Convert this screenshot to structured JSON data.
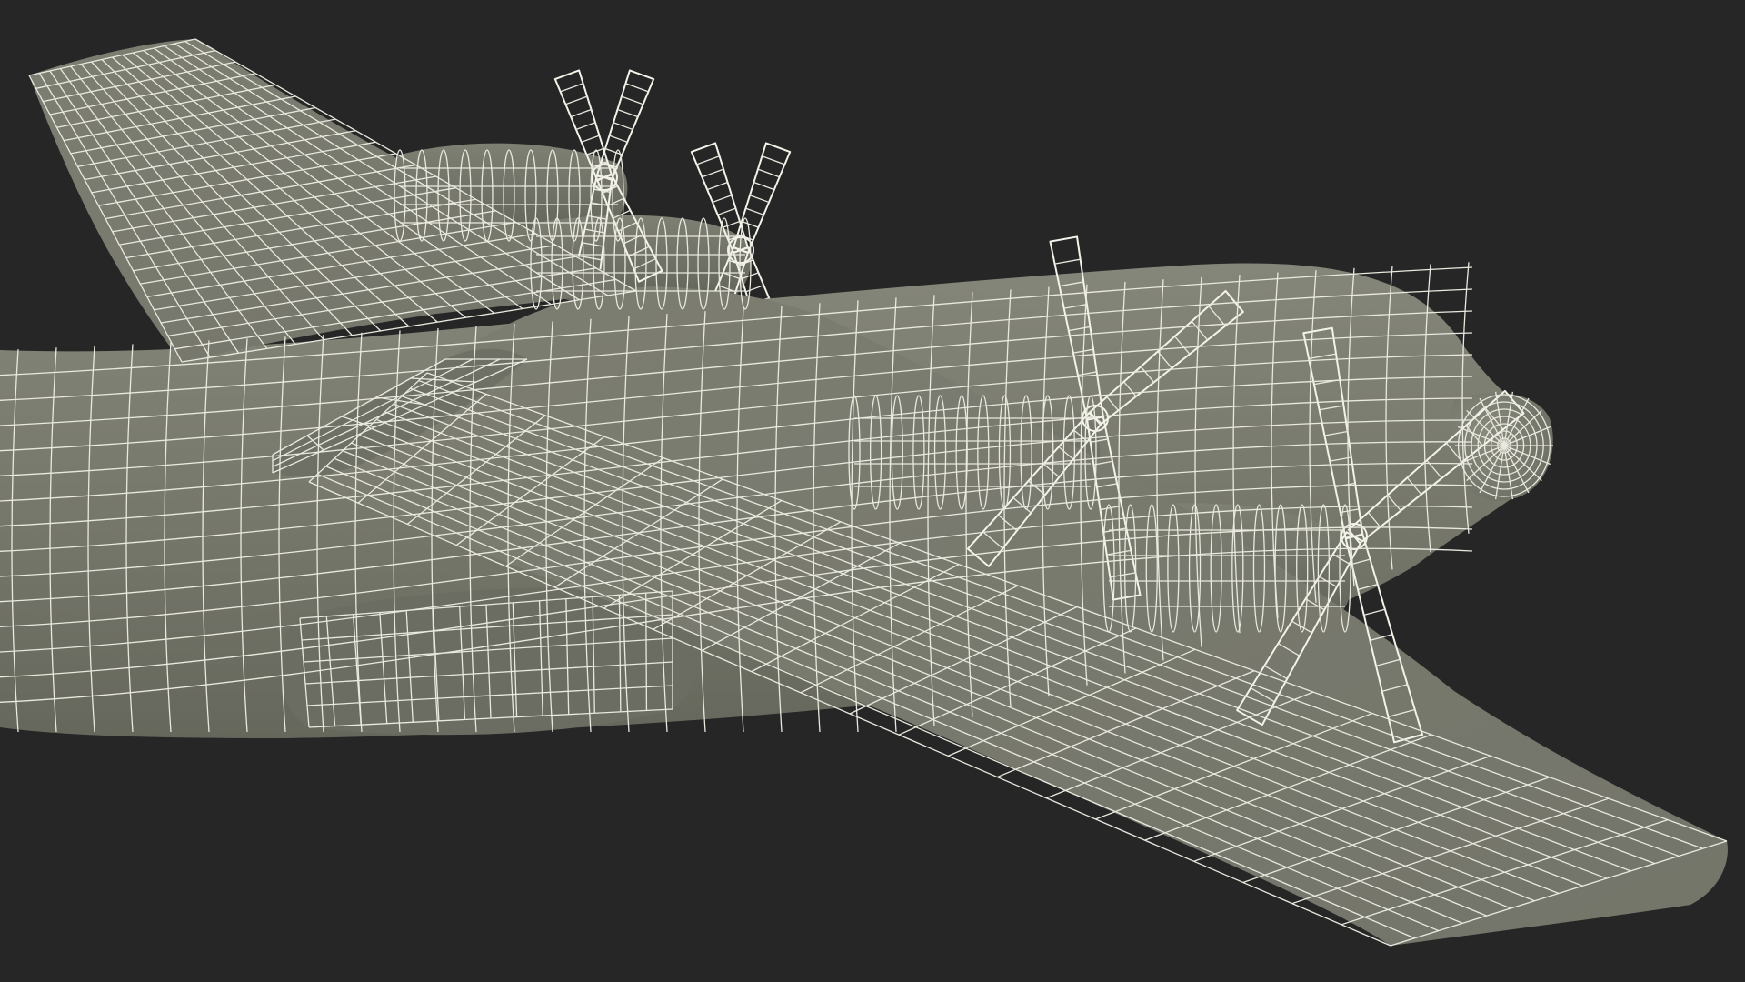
{
  "scene": {
    "subject": "aircraft",
    "render_style": "wireframe",
    "background_color": "#262626",
    "surface_color": "#7b7c70",
    "surface_shade_color": "#5f6056",
    "wire_color": "#e9e9df"
  }
}
